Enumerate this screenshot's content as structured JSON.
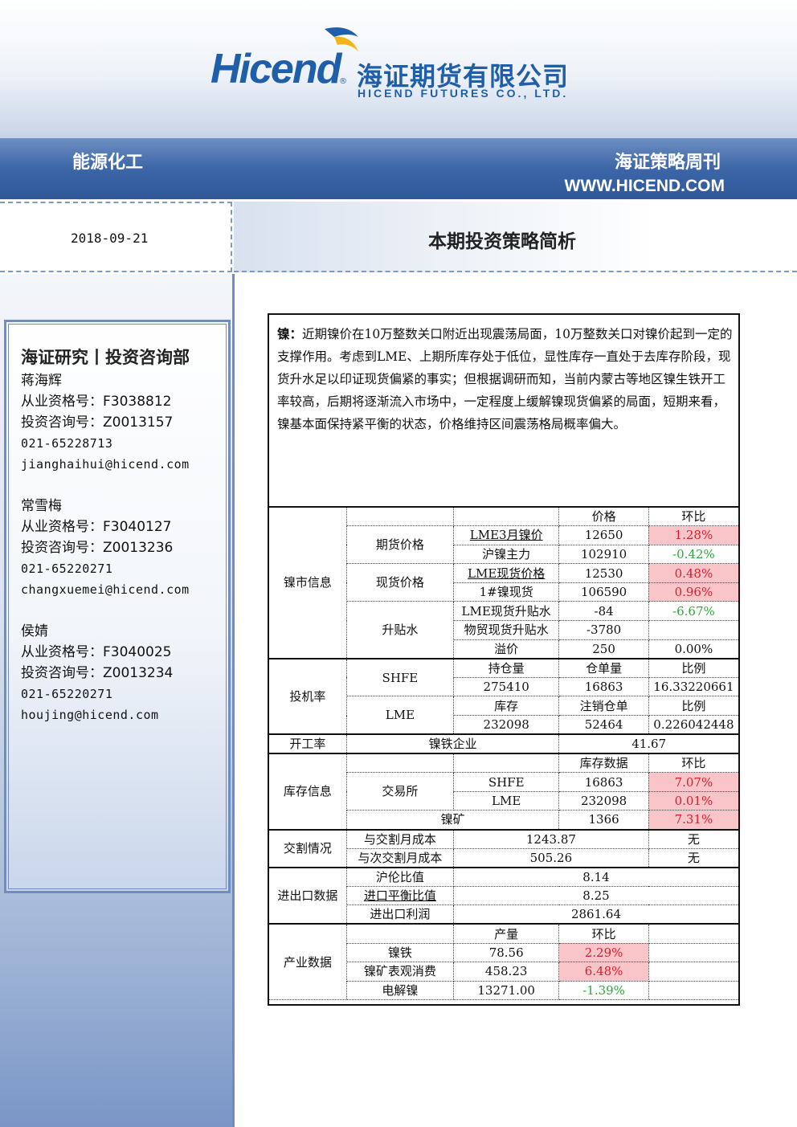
{
  "header": {
    "logo_word": "Hicend",
    "logo_reg": "®",
    "logo_cn": "海证期货有限公司",
    "logo_en": "HICEND FUTURES CO., LTD."
  },
  "band": {
    "left": "能源化工",
    "right": "海证策略周刊",
    "url": "WWW.HICEND.COM"
  },
  "date": "2018-09-21",
  "title": "本期投资策略简析",
  "sidebar": {
    "dept": "海证研究丨投资咨询部",
    "people": [
      {
        "name": "蒋海辉",
        "qual": "从业资格号：F3038812",
        "advis": "投资咨询号：Z0013157",
        "phone": "021-65228713",
        "email": "jianghaihui@hicend.com"
      },
      {
        "name": "常雪梅",
        "qual": "从业资格号：F3040127",
        "advis": "投资咨询号：Z0013236",
        "phone": "021-65220271",
        "email": "changxuemei@hicend.com"
      },
      {
        "name": "侯婧",
        "qual": "从业资格号：F3040025",
        "advis": "投资咨询号：Z0013234",
        "phone": "021-65220271",
        "email": "houjing@hicend.com"
      }
    ]
  },
  "analysis": {
    "label": "镍：",
    "text": "近期镍价在10万整数关口附近出现震荡局面，10万整数关口对镍价起到一定的支撑作用。考虑到LME、上期所库存处于低位，显性库存一直处于去库存阶段，现货升水足以印证现货偏紧的事实；但根据调研而知，当前内蒙古等地区镍生铁开工率较高，后期将逐渐流入市场中，一定程度上缓解镍现货偏紧的局面，短期来看，镍基本面保持紧平衡的状态，价格维持区间震荡格局概率偏大。"
  },
  "table": {
    "market": {
      "section": "镍市信息",
      "h_price": "价格",
      "h_chg": "环比",
      "futures": "期货价格",
      "lme3m": {
        "name": "LME3月镍价",
        "price": "12650",
        "chg": "1.28%"
      },
      "shfe_main": {
        "name": "沪镍主力",
        "price": "102910",
        "chg": "-0.42%"
      },
      "spot": "现货价格",
      "lme_spot": {
        "name": "LME现货价格",
        "price": "12530",
        "chg": "0.48%"
      },
      "cn_spot": {
        "name": "1#镍现货",
        "price": "106590",
        "chg": "0.96%"
      },
      "premium": "升贴水",
      "lme_prem": {
        "name": "LME现货升贴水",
        "price": "-84",
        "chg": "-6.67%"
      },
      "wm_prem": {
        "name": "物贸现货升贴水",
        "price": "-3780",
        "chg": ""
      },
      "overflow": {
        "name": "溢价",
        "price": "250",
        "chg": "0.00%"
      }
    },
    "spec": {
      "section": "投机率",
      "shfe": "SHFE",
      "shfe_h": [
        "持仓量",
        "仓单量",
        "比例"
      ],
      "shfe_v": [
        "275410",
        "16863",
        "16.33220661"
      ],
      "lme": "LME",
      "lme_h": [
        "库存",
        "注销仓单",
        "比例"
      ],
      "lme_v": [
        "232098",
        "52464",
        "0.226042448"
      ]
    },
    "op": {
      "section": "开工率",
      "name": "镍铁企业",
      "value": "41.67"
    },
    "stock": {
      "section": "库存信息",
      "h_data": "库存数据",
      "h_chg": "环比",
      "exch": "交易所",
      "shfe": {
        "name": "SHFE",
        "v": "16863",
        "chg": "7.07%"
      },
      "lme": {
        "name": "LME",
        "v": "232098",
        "chg": "0.01%"
      },
      "ore": {
        "name": "镍矿",
        "v": "1366",
        "chg": "7.31%"
      }
    },
    "delivery": {
      "section": "交割情况",
      "r1": {
        "name": "与交割月成本",
        "v": "1243.87",
        "s": "无"
      },
      "r2": {
        "name": "与次交割月成本",
        "v": "505.26",
        "s": "无"
      }
    },
    "trade": {
      "section": "进出口数据",
      "r1": {
        "name": "沪伦比值",
        "v": "8.14"
      },
      "r2": {
        "name": "进口平衡比值",
        "v": "8.25"
      },
      "r3": {
        "name": "进出口利润",
        "v": "2861.64"
      }
    },
    "industry": {
      "section": "产业数据",
      "h_out": "产量",
      "h_chg": "环比",
      "r1": {
        "name": "镍铁",
        "v": "78.56",
        "chg": "2.29%"
      },
      "r2": {
        "name": "镍矿表观消费",
        "v": "458.23",
        "chg": "6.48%"
      },
      "r3": {
        "name": "电解镍",
        "v": "13271.00",
        "chg": "-1.39%"
      }
    }
  }
}
